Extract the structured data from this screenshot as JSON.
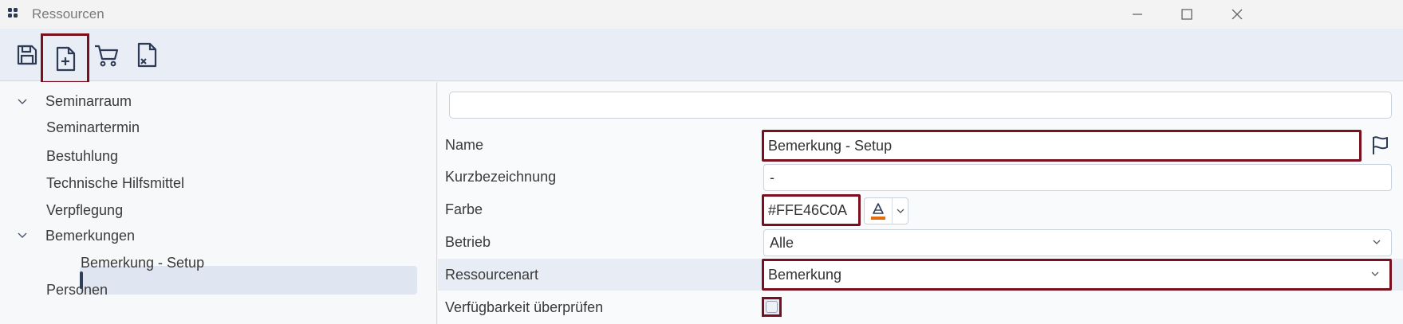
{
  "window": {
    "title": "Ressourcen"
  },
  "toolbar": {
    "buttons": [
      {
        "icon": "save-icon",
        "label": "Speichern"
      },
      {
        "icon": "new-document-icon",
        "label": "Neu"
      },
      {
        "icon": "cart-icon",
        "label": "Warenkorb"
      },
      {
        "icon": "delete-document-icon",
        "label": "Löschen"
      }
    ]
  },
  "tree": {
    "items": [
      {
        "label": "Seminarraum",
        "expanded": true
      },
      {
        "label": "Seminartermin"
      },
      {
        "label": "Bestuhlung"
      },
      {
        "label": "Technische Hilfsmittel"
      },
      {
        "label": "Verpflegung"
      },
      {
        "label": "Bemerkungen",
        "expanded": true
      },
      {
        "label": "Bemerkung - Setup",
        "selected": true
      },
      {
        "label": "Personen"
      }
    ]
  },
  "search": {
    "value": "",
    "placeholder": ""
  },
  "form": {
    "name": {
      "label": "Name",
      "value": "Bemerkung - Setup"
    },
    "kurzbezeichnung": {
      "label": "Kurzbezeichnung",
      "value": "-"
    },
    "farbe": {
      "label": "Farbe",
      "value": "#FFE46C0A",
      "swatch": "#e46c0a"
    },
    "betrieb": {
      "label": "Betrieb",
      "value": "Alle"
    },
    "ressourcenart": {
      "label": "Ressourcenart",
      "value": "Bemerkung"
    },
    "verfuegbarkeit": {
      "label": "Verfügbarkeit überprüfen",
      "checked": false
    }
  },
  "colors": {
    "highlight": "#7a0f1e",
    "accent": "#2f3f5c",
    "swatch": "#e46c0a"
  }
}
